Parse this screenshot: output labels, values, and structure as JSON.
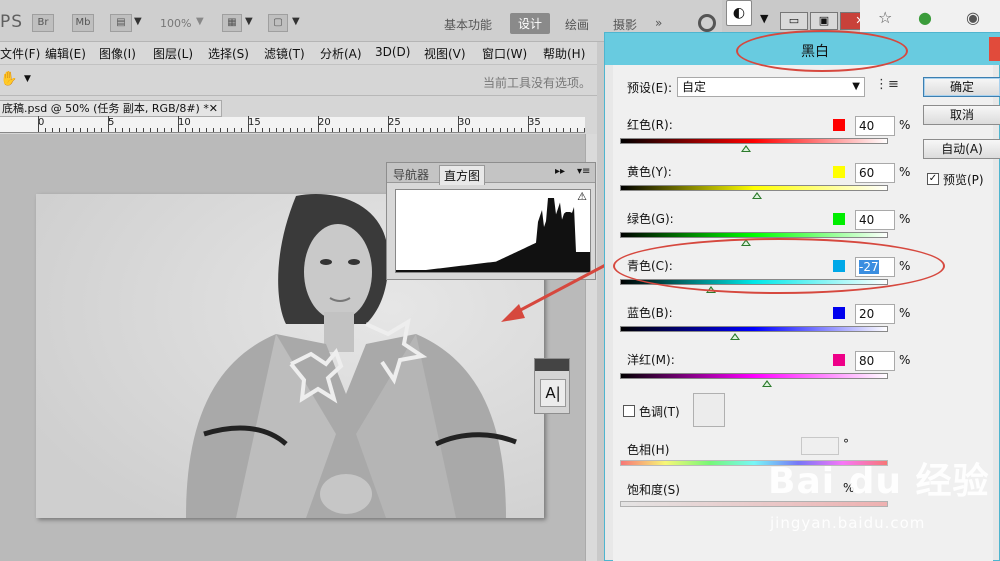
{
  "ps": {
    "logo": "PS",
    "zoom_label": "100%",
    "workspaces": [
      "基本功能",
      "设计",
      "绘画",
      "摄影",
      "»"
    ],
    "menubar": [
      "文件(F)",
      "编辑(E)",
      "图像(I)",
      "图层(L)",
      "选择(S)",
      "滤镜(T)",
      "分析(A)",
      "3D(D)",
      "视图(V)",
      "窗口(W)",
      "帮助(H)"
    ],
    "options_message": "当前工具没有选项。",
    "doc_tab": "底稿.psd @ 50% (任务 副本, RGB/8#) *",
    "doc_close": "✕",
    "ruler_labels": [
      "0",
      "5",
      "10",
      "15",
      "20",
      "25",
      "30",
      "35"
    ],
    "histogram_tabs": [
      "导航器",
      "直方图"
    ],
    "mini_button": "A|"
  },
  "dialog": {
    "title": "黑白",
    "preset_label": "预设(E):",
    "preset_value": "自定",
    "buttons": {
      "ok": "确定",
      "cancel": "取消",
      "auto": "自动(A)"
    },
    "preview_label": "预览(P)",
    "preview_checked": true,
    "sliders": [
      {
        "label": "红色(R):",
        "value": "40",
        "color": "#ff0000",
        "gradient": "linear-gradient(to right,#000,#ff0000,#ffffff)",
        "position": 0.47
      },
      {
        "label": "黄色(Y):",
        "value": "60",
        "color": "#ffff00",
        "gradient": "linear-gradient(to right,#000,#ffff00,#ffffff)",
        "position": 0.51
      },
      {
        "label": "绿色(G):",
        "value": "40",
        "color": "#00ee00",
        "gradient": "linear-gradient(to right,#000,#00ff00,#ffffff)",
        "position": 0.47
      },
      {
        "label": "青色(C):",
        "value": "-27",
        "color": "#00a8e8",
        "gradient": "linear-gradient(to right,#000,#00e8e8,#ffffff)",
        "position": 0.34
      },
      {
        "label": "蓝色(B):",
        "value": "20",
        "color": "#0000ee",
        "gradient": "linear-gradient(to right,#000,#0000ff,#ffffff)",
        "position": 0.43
      },
      {
        "label": "洋红(M):",
        "value": "80",
        "color": "#ee0088",
        "gradient": "linear-gradient(to right,#000,#ff00ff,#ffffff)",
        "position": 0.55
      }
    ],
    "pct": "%",
    "tone_label": "色调(T)",
    "hue_label": "色相(H)",
    "hue_unit": "°",
    "saturation_label": "饱和度(S)",
    "saturation_unit": "%"
  },
  "watermark": {
    "logo": "Bai du 经验",
    "url": "jingyan.baidu.com"
  },
  "colors": {
    "title_bar": "#68cbe0",
    "annotation": "#d6483e"
  }
}
